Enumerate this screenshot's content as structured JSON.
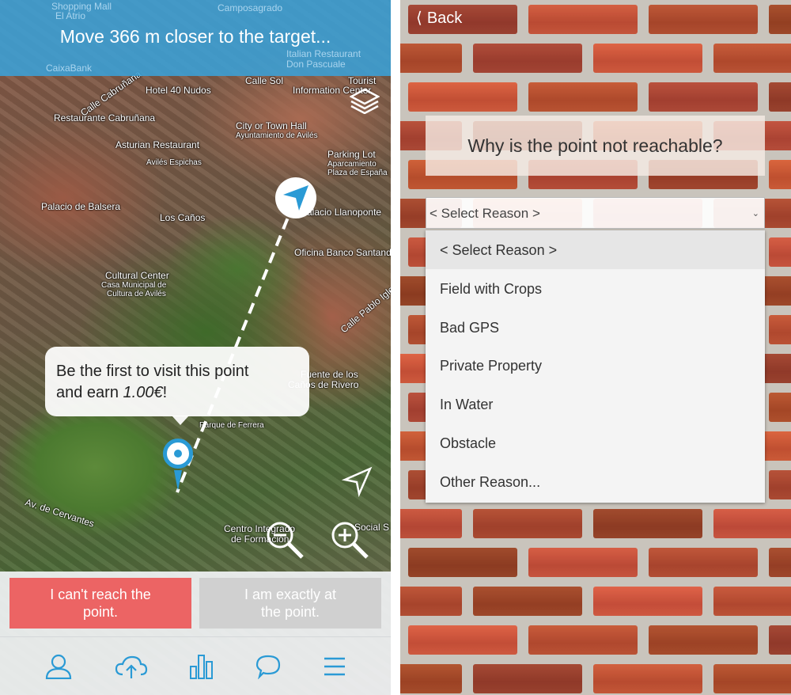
{
  "left": {
    "banner": "Move 366 m closer to the target...",
    "map_labels": [
      "Shopping Mall",
      "El Atrio",
      "Camposagrado",
      "CaixaBank",
      "Italian Restaurant",
      "Don Pascuale",
      "Calle Sol",
      "Tourist",
      "Information Center",
      "Hotel 40 Nudos",
      "Calle Cabruñana",
      "Restaurante Cabruñana",
      "City or Town Hall",
      "Ayuntamiento de Avilés",
      "Asturian Restaurant",
      "Avilés Espichas",
      "Parking Lot",
      "Aparcamiento",
      "Plaza de España",
      "Palacio de Balsera",
      "Los Caños",
      "Palacio Llanoponte",
      "Oficina Banco Santander",
      "Cultural Center",
      "Casa Municipal de",
      "Cultura de Avilés",
      "Calle Pablo Iglesias",
      "Fuente de los",
      "Caños de Rivero",
      "Parque de Ferrera",
      "Av. de Cervantes",
      "Centro Integrado",
      "de Formación",
      "Social S"
    ],
    "bubble": {
      "line1": "Be the first to visit this point",
      "line2_prefix": "and earn ",
      "amount": "1.00€",
      "line2_suffix": "!"
    },
    "buttons": {
      "cant_reach": "I can't reach the point.",
      "exactly_at": "I am exactly at the point."
    },
    "nav_icons": [
      "user-icon",
      "cloud-upload-icon",
      "bar-chart-icon",
      "chat-icon",
      "menu-icon"
    ],
    "colors": {
      "accent": "#2a9ad5",
      "cant_reach": "#ec6464",
      "disabled": "#d0d0d0"
    }
  },
  "right": {
    "back": "Back",
    "question": "Why is the point not reachable?",
    "select_value": "< Select Reason >",
    "options": [
      "< Select Reason >",
      "Field with Crops",
      "Bad GPS",
      "Private Property",
      "In Water",
      "Obstacle",
      "Other Reason..."
    ]
  }
}
